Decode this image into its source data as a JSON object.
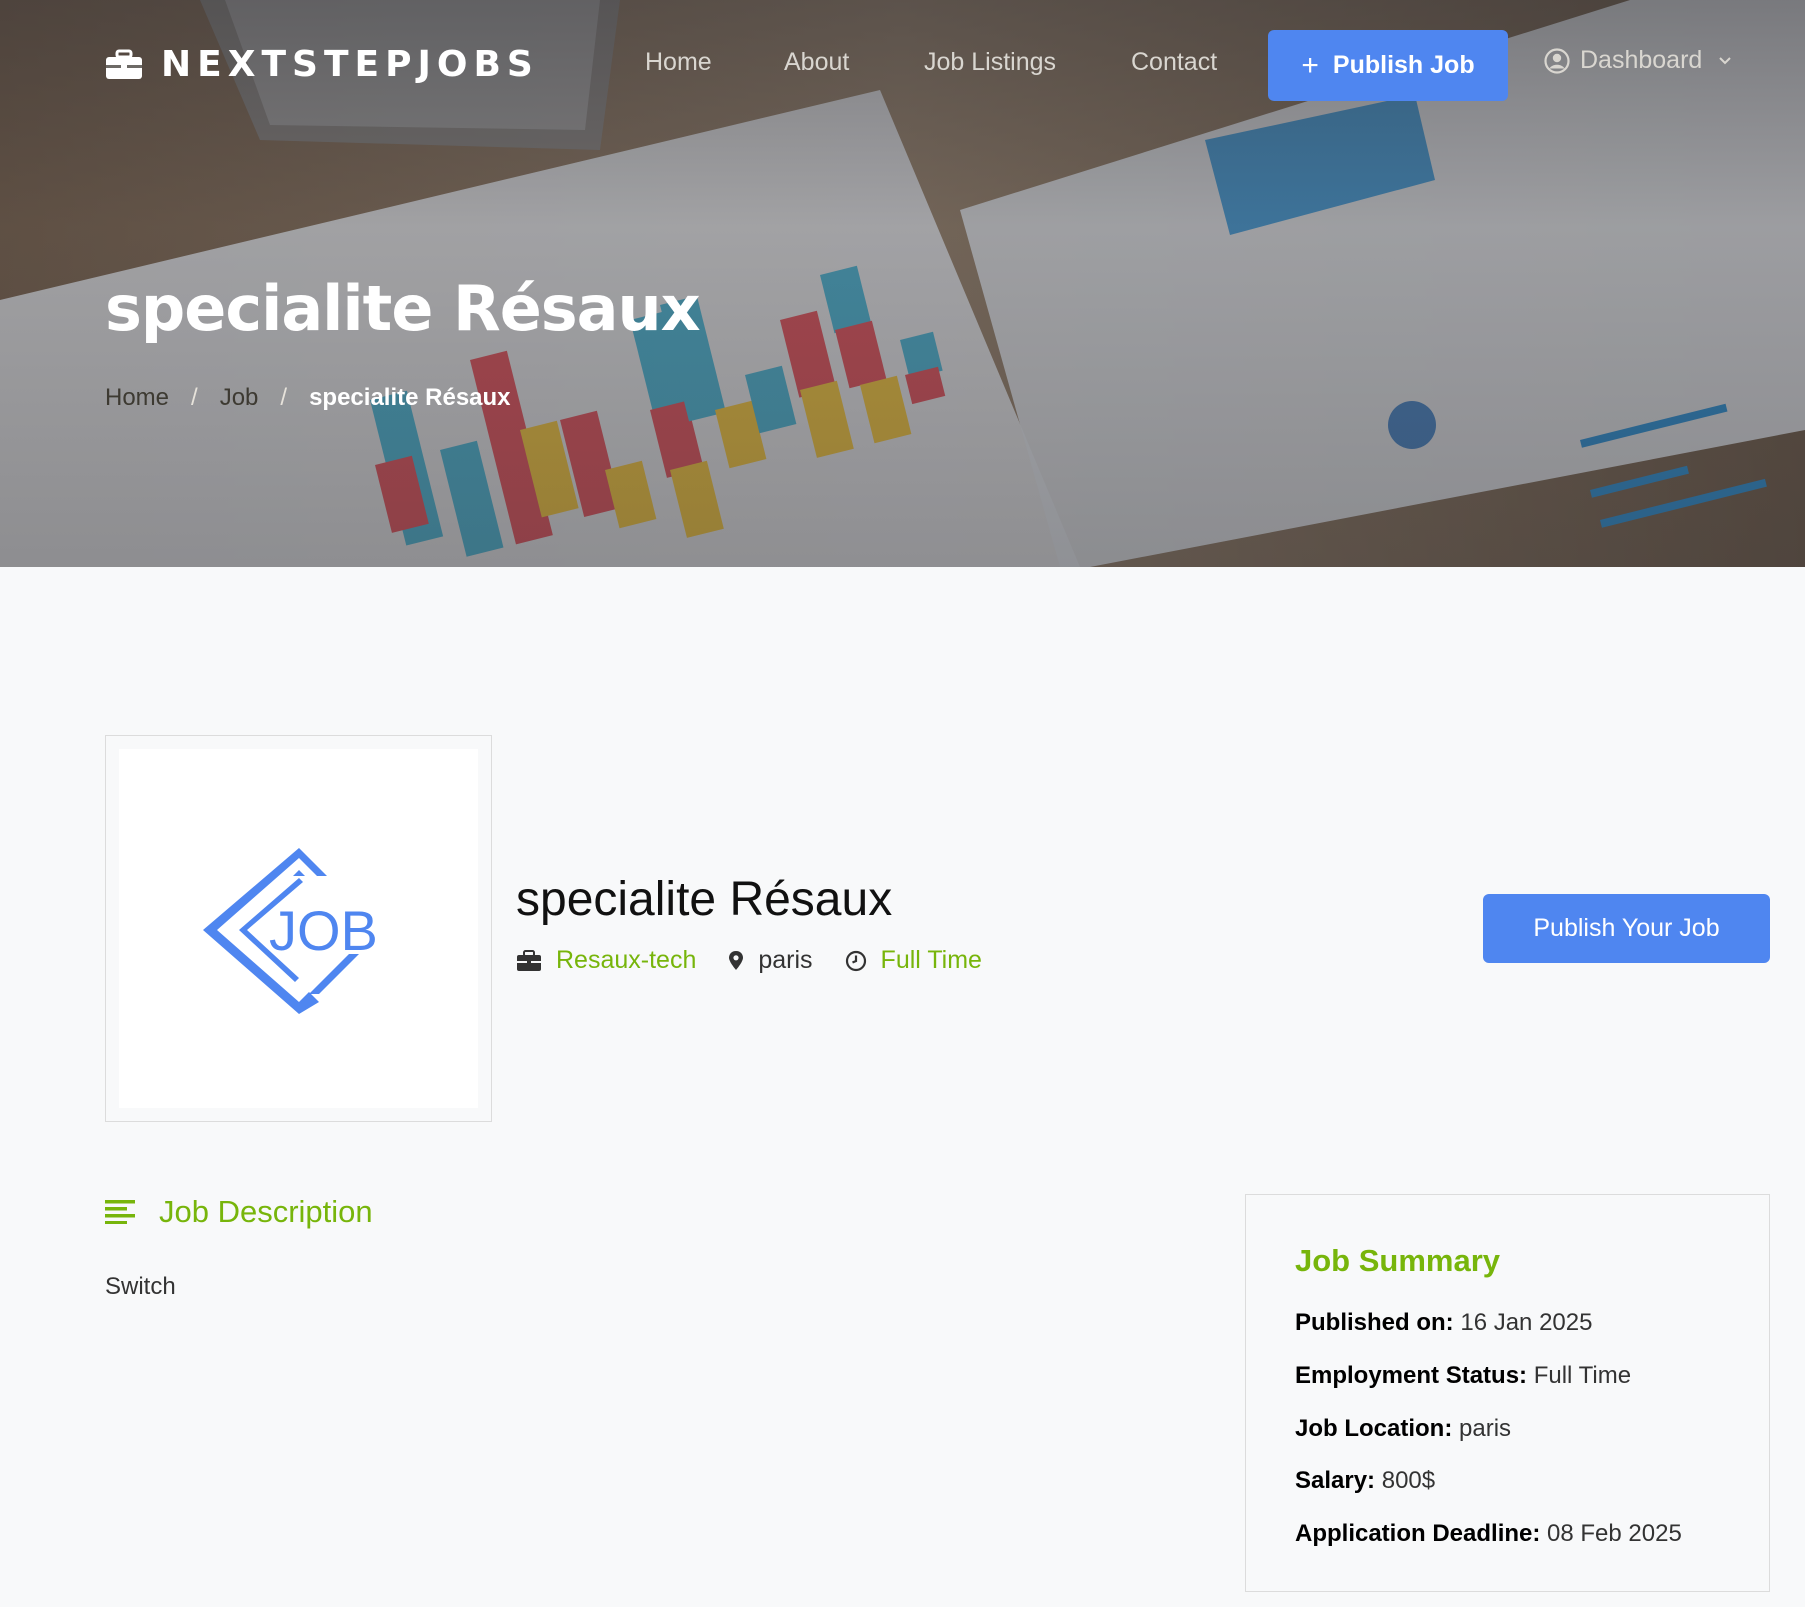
{
  "brand": {
    "name": "NEXTSTEPJOBS",
    "icon": "briefcase-icon"
  },
  "nav": {
    "links": [
      "Home",
      "About",
      "Job Listings",
      "Contact"
    ],
    "publish_label": "Publish Job",
    "dashboard_label": "Dashboard"
  },
  "hero": {
    "title": "specialite Résaux",
    "breadcrumb": {
      "home": "Home",
      "job": "Job",
      "current": "specialite Résaux"
    }
  },
  "job": {
    "title": "specialite Résaux",
    "company": "Resaux-tech",
    "location": "paris",
    "type": "Full Time",
    "logo_text": "JOB",
    "publish_your_job_label": "Publish Your Job"
  },
  "description": {
    "heading": "Job Description",
    "body": "Switch"
  },
  "summary": {
    "heading": "Job Summary",
    "rows": [
      {
        "label": "Published on:",
        "value": "16 Jan 2025"
      },
      {
        "label": "Employment Status:",
        "value": "Full Time"
      },
      {
        "label": "Job Location:",
        "value": "paris"
      },
      {
        "label": "Salary:",
        "value": "800$"
      },
      {
        "label": "Application Deadline:",
        "value": "08 Feb 2025"
      }
    ]
  },
  "colors": {
    "accent_blue": "#4f86f0",
    "accent_green": "#77b50b",
    "page_background": "#f8f9fa"
  }
}
